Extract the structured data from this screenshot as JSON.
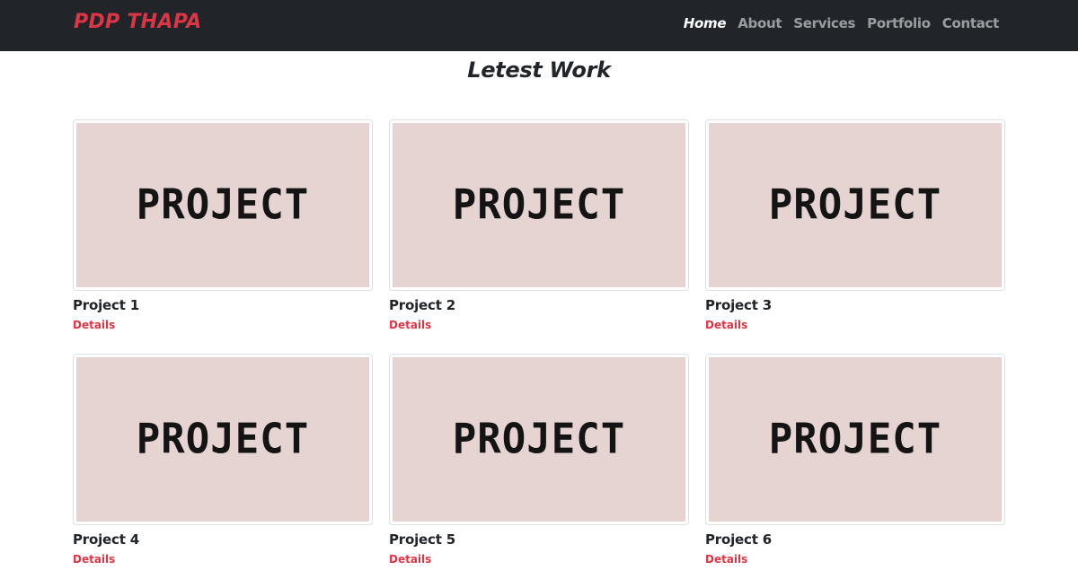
{
  "nav": {
    "brand": "PDP THAPA",
    "links": [
      {
        "label": "Home",
        "active": true
      },
      {
        "label": "About",
        "active": false
      },
      {
        "label": "Services",
        "active": false
      },
      {
        "label": "Portfolio",
        "active": false
      },
      {
        "label": "Contact",
        "active": false
      }
    ]
  },
  "section": {
    "title": "Letest Work"
  },
  "projects": [
    {
      "image_text": "PROJECT",
      "title": "Project 1",
      "link": "Details"
    },
    {
      "image_text": "PROJECT",
      "title": "Project 2",
      "link": "Details"
    },
    {
      "image_text": "PROJECT",
      "title": "Project 3",
      "link": "Details"
    },
    {
      "image_text": "PROJECT",
      "title": "Project 4",
      "link": "Details"
    },
    {
      "image_text": "PROJECT",
      "title": "Project 5",
      "link": "Details"
    },
    {
      "image_text": "PROJECT",
      "title": "Project 6",
      "link": "Details"
    }
  ],
  "colors": {
    "navbar_bg": "#212529",
    "brand": "#dc3545",
    "accent_link": "#dc3545",
    "thumb_bg": "#e5d4d2"
  }
}
